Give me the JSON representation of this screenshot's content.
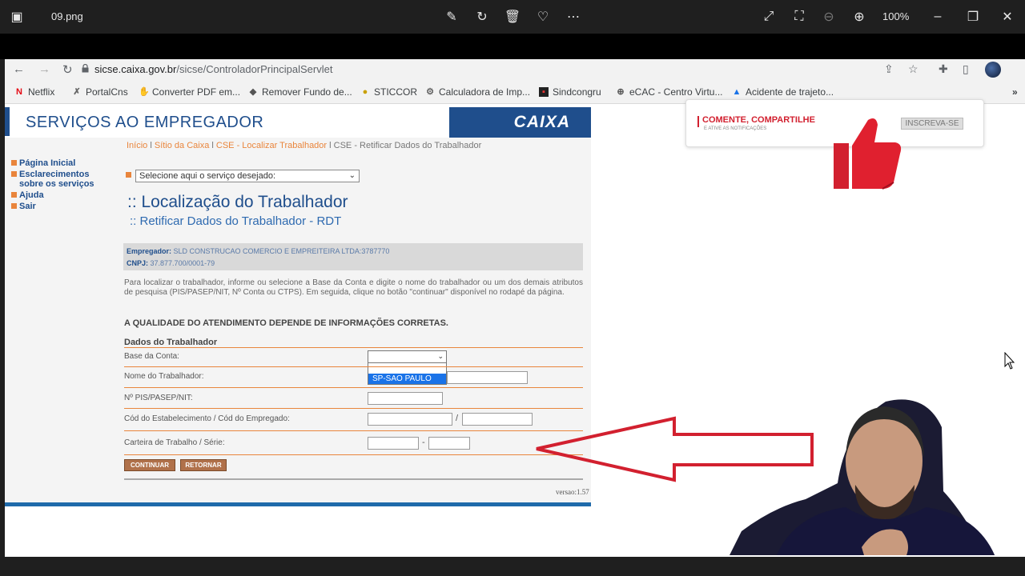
{
  "viewer": {
    "filename": "09.png",
    "zoom": "100%"
  },
  "browser": {
    "url_host": "sicse.caixa.gov.br",
    "url_path": "/sicse/ControladorPrincipalServlet",
    "bookmarks": [
      {
        "label": "Netflix",
        "icon": "netflix-icon"
      },
      {
        "label": "PortalCns",
        "icon": "portal-icon"
      },
      {
        "label": "Converter PDF em...",
        "icon": "pdf-icon"
      },
      {
        "label": "Remover Fundo de...",
        "icon": "remove-bg-icon"
      },
      {
        "label": "STICCOR",
        "icon": "sticcor-icon"
      },
      {
        "label": "Calculadora de Imp...",
        "icon": "calculator-icon"
      },
      {
        "label": "Sindcongru",
        "icon": "sindcongru-icon"
      },
      {
        "label": "eCAC - Centro Virtu...",
        "icon": "globe-icon"
      },
      {
        "label": "Acidente de trajeto...",
        "icon": "drive-icon"
      }
    ]
  },
  "site": {
    "title": "SERVIÇOS AO EMPREGADOR",
    "logo": "CAIXA",
    "menu": [
      "Página Inicial",
      "Esclarecimentos sobre os serviços",
      "Ajuda",
      "Sair"
    ],
    "breadcrumb": {
      "b1": "Início",
      "b2": "Sítio da Caixa",
      "b3": "CSE - Localizar Trabalhador",
      "b4": "CSE - Retificar Dados do Trabalhador"
    },
    "service_select": "Selecione aqui o serviço desejado:",
    "heading": ":: Localização do Trabalhador",
    "subheading": ":: Retificar Dados do Trabalhador - RDT",
    "employer_label": "Empregador:",
    "employer_value": "SLD CONSTRUCAO COMERCIO E EMPREITEIRA LTDA:3787770",
    "cnpj_label": "CNPJ:",
    "cnpj_value": "37.877.700/0001-79",
    "instructions": "Para localizar o trabalhador, informe ou selecione a Base da Conta e digite o nome do trabalhador ou um dos demais atributos de pesquisa (PIS/PASEP/NIT, Nº Conta ou CTPS). Em seguida, clique no botão \"continuar\" disponível no rodapé da página.",
    "warning": "A QUALIDADE DO ATENDIMENTO DEPENDE DE INFORMAÇÕES CORRETAS.",
    "section_title": "Dados do Trabalhador",
    "fields": {
      "base": "Base da Conta:",
      "nome": "Nome do Trabalhador:",
      "pis": "Nº PIS/PASEP/NIT:",
      "cod": "Cód do Estabelecimento / Cód do Empregado:",
      "ctps": "Carteira de Trabalho / Série:"
    },
    "dropdown_option": "SP-SAO PAULO",
    "buttons": {
      "continue": "CONTINUAR",
      "back": "RETORNAR"
    },
    "version": "versao:1.57"
  },
  "promo": {
    "title": "COMENTE, COMPARTILHE",
    "subtitle": "E ATIVE AS NOTIFICAÇÕES",
    "button": "INSCREVA-SE"
  },
  "colors": {
    "brand_blue": "#1f4e8c",
    "orange": "#e9853c",
    "arrow_red": "#d2202f"
  }
}
